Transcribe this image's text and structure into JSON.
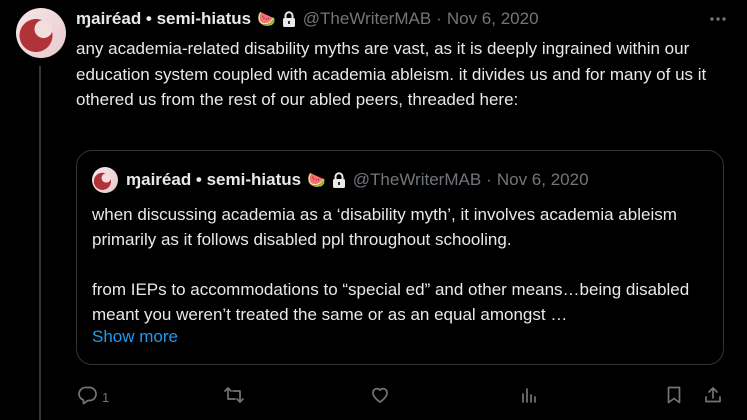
{
  "tweet": {
    "author_name": "ɱairéad • semi-hiatus",
    "emoji": "🍉",
    "handle": "@TheWriterMAB",
    "separator": "·",
    "date": "Nov 6, 2020",
    "text": "any academia-related disability myths are vast, as it is deeply ingrained within our education system coupled with academia ableism. it divides us and for many of us it othered us from the rest of our abled peers, threaded here:"
  },
  "quote": {
    "author_name": "ɱairéad • semi-hiatus",
    "emoji": "🍉",
    "handle": "@TheWriterMAB",
    "separator": "·",
    "date": "Nov 6, 2020",
    "text": "when discussing academia as a ‘disability myth’, it involves academia ableism primarily as it follows disabled ppl throughout schooling.\n\nfrom IEPs to accommodations to “special ed” and other means…being disabled meant you weren’t treated the same or as an equal amongst …",
    "show_more": "Show more"
  },
  "actions": {
    "reply_count": "1"
  },
  "icons": {
    "verified_lock": "lock-icon",
    "more": "more-icon",
    "reply": "reply-icon",
    "retweet": "retweet-icon",
    "like": "like-icon",
    "views": "views-icon",
    "bookmark": "bookmark-icon",
    "share": "share-icon"
  },
  "colors": {
    "background": "#000000",
    "text": "#e7e9ea",
    "secondary": "#71767b",
    "link": "#1d9bf0",
    "border": "#2f3336"
  }
}
